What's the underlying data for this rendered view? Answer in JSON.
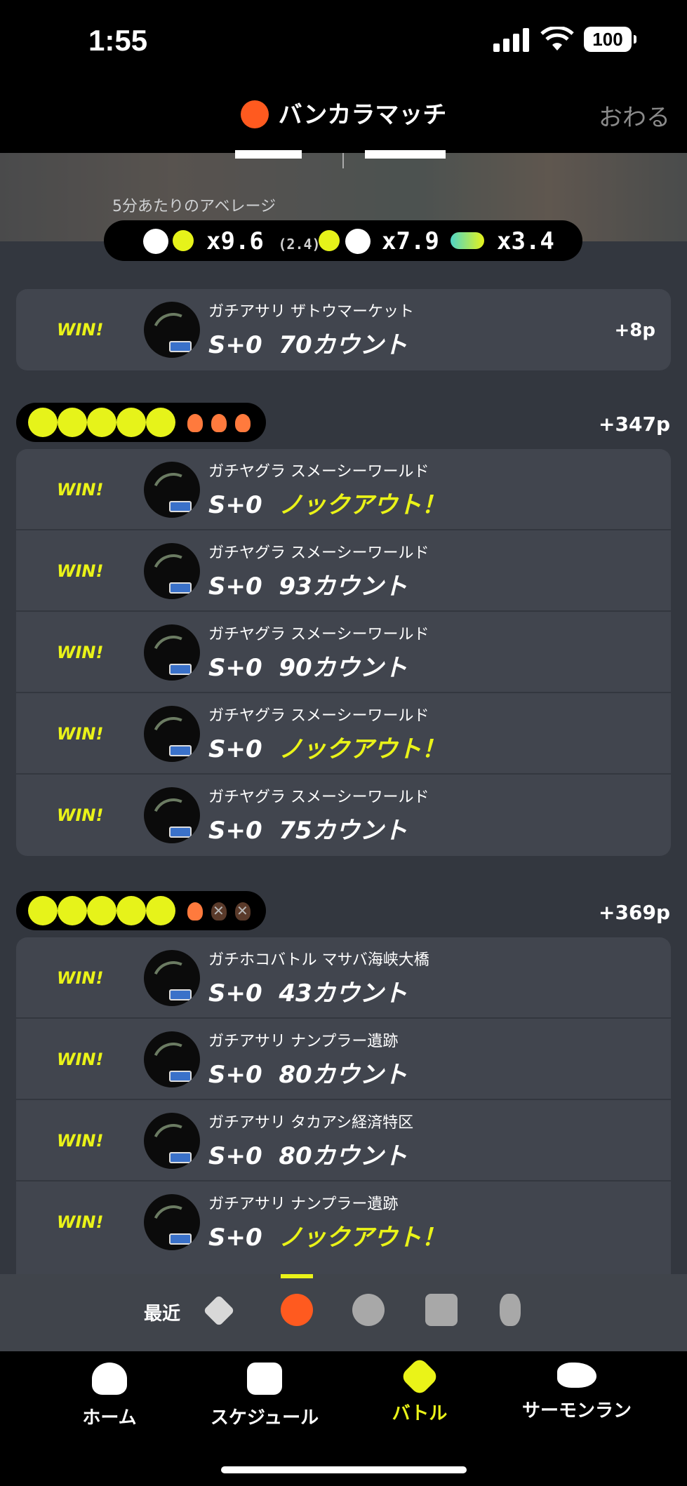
{
  "status": {
    "time": "1:55",
    "battery": "100"
  },
  "header": {
    "title": "バンカラマッチ",
    "close": "おわる"
  },
  "averages": {
    "label": "5分あたりのアベレージ",
    "kills": "x9.6",
    "assists": "(2.4)",
    "deaths": "x7.9",
    "specials": "x3.4"
  },
  "single": {
    "result": "WIN!",
    "mode": "ガチアサリ ザトウマーケット",
    "rank": "S+0",
    "score": "70カウント",
    "points": "+8p"
  },
  "series1": {
    "points": "+347p",
    "matches": [
      {
        "result": "WIN!",
        "mode": "ガチヤグラ スメーシーワールド",
        "rank": "S+0",
        "score": "ノックアウト！",
        "ko": true
      },
      {
        "result": "WIN!",
        "mode": "ガチヤグラ スメーシーワールド",
        "rank": "S+0",
        "score": "93カウント",
        "ko": false
      },
      {
        "result": "WIN!",
        "mode": "ガチヤグラ スメーシーワールド",
        "rank": "S+0",
        "score": "90カウント",
        "ko": false
      },
      {
        "result": "WIN!",
        "mode": "ガチヤグラ スメーシーワールド",
        "rank": "S+0",
        "score": "ノックアウト！",
        "ko": true
      },
      {
        "result": "WIN!",
        "mode": "ガチヤグラ スメーシーワールド",
        "rank": "S+0",
        "score": "75カウント",
        "ko": false
      }
    ]
  },
  "series2": {
    "points": "+369p",
    "matches": [
      {
        "result": "WIN!",
        "mode": "ガチホコバトル マサバ海峡大橋",
        "rank": "S+0",
        "score": "43カウント",
        "ko": false
      },
      {
        "result": "WIN!",
        "mode": "ガチアサリ ナンプラー遺跡",
        "rank": "S+0",
        "score": "80カウント",
        "ko": false
      },
      {
        "result": "WIN!",
        "mode": "ガチアサリ タカアシ経済特区",
        "rank": "S+0",
        "score": "80カウント",
        "ko": false
      },
      {
        "result": "WIN!",
        "mode": "ガチアサリ ナンプラー遺跡",
        "rank": "S+0",
        "score": "ノックアウト！",
        "ko": true
      }
    ]
  },
  "filters": {
    "label": "最近"
  },
  "tabs": {
    "home": "ホーム",
    "schedule": "スケジュール",
    "battle": "バトル",
    "salmon": "サーモンラン"
  },
  "colors": {
    "accent": "#eaf318",
    "bankara": "#ff5a1f",
    "card": "#41454e"
  }
}
